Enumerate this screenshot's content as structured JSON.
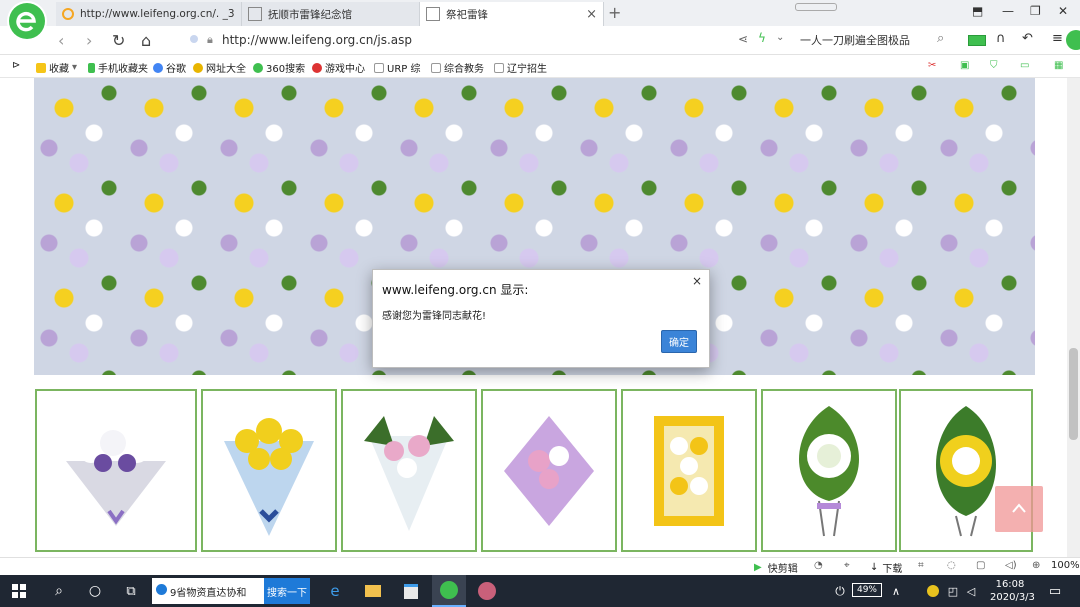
{
  "tabs": [
    {
      "label": "http://www.leifeng.org.cn/. _3",
      "active": false
    },
    {
      "label": "抚顺市雷锋纪念馆",
      "active": false
    },
    {
      "label": "祭祀雷锋",
      "active": true
    }
  ],
  "address": {
    "url": "http://www.leifeng.org.cn/js.asp",
    "search": "一人一刀刷遍全图极品"
  },
  "bookmarks": [
    "收藏",
    "手机收藏夹",
    "谷歌",
    "网址大全",
    "360搜索",
    "游戏中心",
    "URP 综",
    "综合教务",
    "辽宁招生"
  ],
  "dialog": {
    "title": "www.leifeng.org.cn 显示:",
    "message": "感谢您为雷锋同志献花!",
    "ok_label": "确定",
    "close_glyph": "×"
  },
  "thumbnails": [
    {
      "name": "white-purple-bouquet",
      "colors": [
        "#e8e8f0",
        "#6a4ca0",
        "#ffffff"
      ]
    },
    {
      "name": "yellow-blue-bouquet",
      "colors": [
        "#f1cf1d",
        "#9fc3e6",
        "#2a4d9a"
      ]
    },
    {
      "name": "pink-lily-bouquet",
      "colors": [
        "#e9a9c9",
        "#3b6e2a",
        "#ffffff"
      ]
    },
    {
      "name": "lily-purple-bouquet",
      "colors": [
        "#c9a6e0",
        "#e8a2c8",
        "#ffffff"
      ]
    },
    {
      "name": "yellow-orange-bouquet",
      "colors": [
        "#f3c417",
        "#f5e9b0",
        "#ffffff"
      ]
    },
    {
      "name": "green-wreath",
      "colors": [
        "#4c8a2b",
        "#ffffff",
        "#b58ad8"
      ]
    },
    {
      "name": "yellow-white-wreath",
      "colors": [
        "#f0d01d",
        "#ffffff",
        "#3c7c2a"
      ]
    }
  ],
  "statusbar": {
    "clip_label": "快剪辑",
    "download_label": "下载",
    "zoom": "100%"
  },
  "taskbar": {
    "search_text": "9省物资直达协和",
    "search_button": "搜索一下",
    "battery": "49%",
    "time": "16:08",
    "date": "2020/3/3"
  },
  "colors": {
    "accent_green": "#3fbf4f",
    "thumb_border": "#7bb560",
    "ok_blue": "#3b84d8",
    "taskbar": "#1f2733"
  },
  "icons": [
    "back-icon",
    "forward-icon",
    "refresh-icon",
    "home-icon",
    "lock-icon",
    "share-icon",
    "search-icon",
    "battery-icon",
    "headphones-icon",
    "undo-icon",
    "menu-icon",
    "up-arrow-icon",
    "windows-icon",
    "cortana-icon",
    "taskview-icon",
    "edge-icon",
    "folder-icon",
    "store-icon",
    "notification-icon"
  ]
}
